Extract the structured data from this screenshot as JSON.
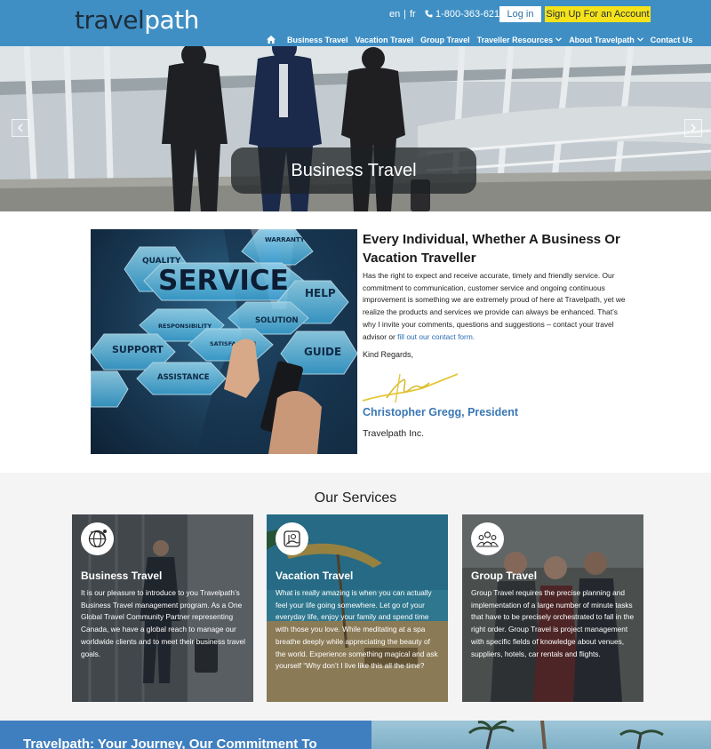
{
  "header": {
    "logo": {
      "part1": "travel",
      "part2": "path"
    },
    "lang_en": "en",
    "separator": "|",
    "lang_fr": "fr",
    "phone": "1-800-363-6211",
    "login_label": "Log in",
    "signup_label": "Sign Up For an Account"
  },
  "nav": {
    "items": [
      "Business Travel",
      "Vacation Travel",
      "Group Travel",
      "Traveller Resources",
      "About Travelpath",
      "Contact Us"
    ]
  },
  "hero": {
    "caption": "Business Travel"
  },
  "intro": {
    "image_words": {
      "service": "SERVICE",
      "quality": "QUALITY",
      "warranty": "WARRANTY",
      "help": "HELP",
      "responsibility": "RESPONSIBILITY",
      "solution": "SOLUTION",
      "support": "SUPPORT",
      "satisfaction": "SATISFACTION",
      "guide": "GUIDE",
      "assistance": "ASSISTANCE"
    },
    "heading": "Every Individual, Whether A Business Or Vacation Traveller",
    "body": "Has the right to expect and receive accurate, timely and friendly service. Our commitment to communication, customer service and ongoing continuous improvement is something we are extremely proud of here at Travelpath, yet we realize the products and services we provide can always be enhanced. That’s why I invite your comments, questions and suggestions – contact your travel advisor or",
    "link": "fill out our contact form.",
    "closing": "Kind Regards,",
    "president": "Christopher Gregg, President",
    "company": "Travelpath Inc."
  },
  "services": {
    "title": "Our Services",
    "cards": [
      {
        "title": "Business Travel",
        "text": "It is our pleasure to introduce to you Travelpath’s Business Travel management program. As a One Global Travel Community Partner representing Canada, we have a global reach to manage our worldwide clients and to meet their business travel goals."
      },
      {
        "title": "Vacation Travel",
        "text": "What is really amazing is when you can actually feel your life going somewhere. Let go of your everyday life, enjoy your family and spend time with those you love. While meditating at a spa breathe deeply while appreciating the beauty of the world. Experience something magical and ask yourself “Why don’t I live like this all the time?"
      },
      {
        "title": "Group Travel",
        "text": "Group Travel requires the precise planning and implementation of a large number of minute tasks that have to be precisely orchestrated to fall in the right order. Group Travel is project management with specific fields of knowledge about venues, suppliers, hotels, car rentals and flights."
      }
    ]
  },
  "bottom": {
    "heading": "Travelpath: Your Journey, Our Commitment To"
  },
  "colors": {
    "header_blue": "#3f8fc4",
    "accent_yellow": "#f6e21b",
    "link_blue": "#2a6db5",
    "band_blue": "#3f7fc0"
  }
}
